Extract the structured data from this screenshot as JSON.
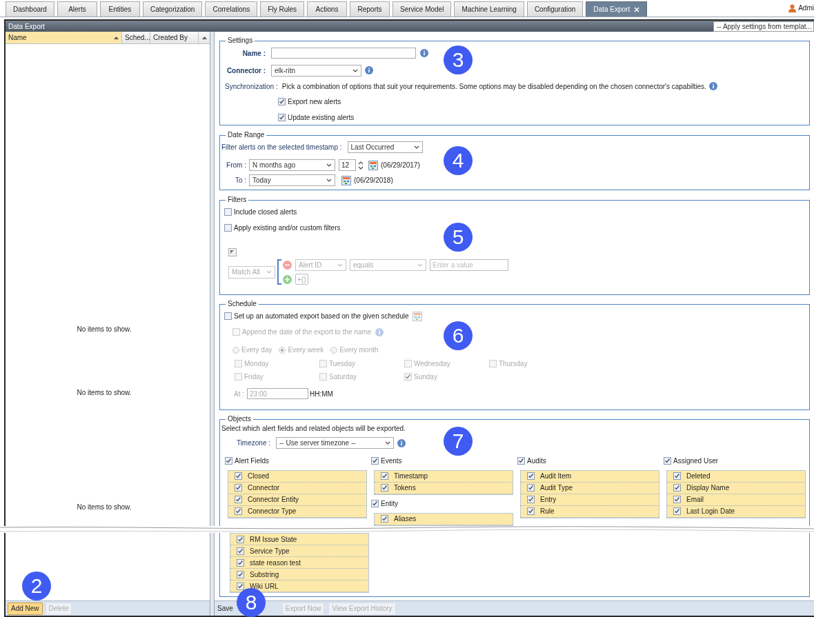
{
  "tabs": [
    {
      "label": "Dashboard",
      "selected": false
    },
    {
      "label": "Alerts",
      "selected": false
    },
    {
      "label": "Entities",
      "selected": false
    },
    {
      "label": "Categorization",
      "selected": false
    },
    {
      "label": "Correlations",
      "selected": false
    },
    {
      "label": "Fly Rules",
      "selected": false
    },
    {
      "label": "Actions",
      "selected": false
    },
    {
      "label": "Reports",
      "selected": false
    },
    {
      "label": "Service Model",
      "selected": false
    },
    {
      "label": "Machine Learning",
      "selected": false
    },
    {
      "label": "Configuration",
      "selected": false
    },
    {
      "label": "Data Export",
      "selected": true
    }
  ],
  "user": {
    "label": "Admi"
  },
  "panel_title": "Data Export",
  "template_select": {
    "value": "-- Apply settings from templat..."
  },
  "list": {
    "columns": [
      {
        "label": "Name",
        "sorted": true
      },
      {
        "label": "Sched...",
        "sorted": false
      },
      {
        "label": "Created By",
        "sorted": false
      }
    ],
    "empty_messages": [
      "No items to show.",
      "No items to show.",
      "No items to show."
    ]
  },
  "list_toolbar": {
    "callout": "2",
    "buttons": [
      {
        "label": "Add New",
        "disabled": false
      },
      {
        "label": "Delete",
        "disabled": true
      }
    ]
  },
  "settings": {
    "legend": "Settings",
    "callout": "3",
    "name": {
      "label": "Name :"
    },
    "connector": {
      "label": "Connector :",
      "value": "elk-ritn"
    },
    "synchronization": {
      "label": "Synchronization :",
      "text": "Pick a combination of options that suit your requirements. Some options may be disabled depending on the chosen connector's capabilties."
    },
    "options": [
      {
        "label": "Export new alerts",
        "checked": true
      },
      {
        "label": "Update existing alerts",
        "checked": true
      }
    ]
  },
  "date_range": {
    "legend": "Date Range",
    "callout": "4",
    "timestamp": {
      "label": "Filter alerts on the selected timestamp :",
      "value": "Last Occurred"
    },
    "from": {
      "label": "From :",
      "value": "N months ago",
      "count": "12",
      "date": "(06/29/2017)"
    },
    "to": {
      "label": "To :",
      "value": "Today",
      "date": "(06/29/2018)"
    }
  },
  "filters": {
    "legend": "Filters",
    "callout": "5",
    "options": [
      {
        "label": "Include closed alerts",
        "checked": false
      },
      {
        "label": "Apply existing and/or custom filters",
        "checked": false
      }
    ],
    "match": "Match All",
    "condition": {
      "field": "Alert ID",
      "operator": "equals",
      "placeholder": "Enter a value"
    },
    "group_button": "+()"
  },
  "schedule": {
    "legend": "Schedule",
    "callout": "6",
    "enable": {
      "label": "Set up an automated export based on the given schedule",
      "checked": false
    },
    "append": {
      "label": "Append the date of the export to the name",
      "checked": false
    },
    "frequencies": [
      {
        "label": "Every day",
        "selected": false
      },
      {
        "label": "Every week",
        "selected": true
      },
      {
        "label": "Every month",
        "selected": false
      }
    ],
    "days": [
      {
        "label": "Monday",
        "checked": false
      },
      {
        "label": "Tuesday",
        "checked": false
      },
      {
        "label": "Wednesday",
        "checked": false
      },
      {
        "label": "Thursday",
        "checked": false
      },
      {
        "label": "Friday",
        "checked": false
      },
      {
        "label": "Saturday",
        "checked": false
      },
      {
        "label": "Sunday",
        "checked": true
      }
    ],
    "time": {
      "label": "At :",
      "value": "23:00",
      "format": "HH:MM"
    }
  },
  "objects": {
    "legend": "Objects",
    "callout": "7",
    "description": "Select which alert fields and related objects will be exported.",
    "timezone": {
      "label": "Timezone :",
      "value": "-- Use server timezone --"
    },
    "columns": [
      {
        "groups": [
          {
            "title": "Alert Fields",
            "checked": true,
            "items": [
              {
                "label": "Closed",
                "checked": true
              },
              {
                "label": "Connector",
                "checked": true
              },
              {
                "label": "Connector Entity",
                "checked": true
              },
              {
                "label": "Connector Type",
                "checked": true
              }
            ],
            "continued_items": [
              {
                "label": "RM Issue State",
                "checked": true
              },
              {
                "label": "Service Type",
                "checked": true
              },
              {
                "label": "state reason test",
                "checked": true
              },
              {
                "label": "Substring",
                "checked": true
              },
              {
                "label": "Wiki URL",
                "checked": true
              }
            ]
          }
        ]
      },
      {
        "groups": [
          {
            "title": "Events",
            "checked": true,
            "items": [
              {
                "label": "Timestamp",
                "checked": true
              },
              {
                "label": "Tokens",
                "checked": true
              }
            ]
          },
          {
            "title": "Entity",
            "checked": true,
            "items": [
              {
                "label": "Aliases",
                "checked": true
              }
            ]
          }
        ]
      },
      {
        "groups": [
          {
            "title": "Audits",
            "checked": true,
            "items": [
              {
                "label": "Audit Item",
                "checked": true
              },
              {
                "label": "Audit Type",
                "checked": true
              },
              {
                "label": "Entry",
                "checked": true
              },
              {
                "label": "Rule",
                "checked": true
              }
            ]
          }
        ]
      },
      {
        "groups": [
          {
            "title": "Assigned User",
            "checked": true,
            "items": [
              {
                "label": "Deleted",
                "checked": true
              },
              {
                "label": "Display Name",
                "checked": true
              },
              {
                "label": "Email",
                "checked": true
              },
              {
                "label": "Last Login Date",
                "checked": true
              }
            ]
          }
        ]
      }
    ]
  },
  "bottom_toolbar": {
    "callout": "8",
    "buttons": [
      {
        "label": "Save",
        "disabled": false
      },
      {
        "label": "Export Now",
        "disabled": true
      },
      {
        "label": "View Export History",
        "disabled": true
      }
    ]
  }
}
